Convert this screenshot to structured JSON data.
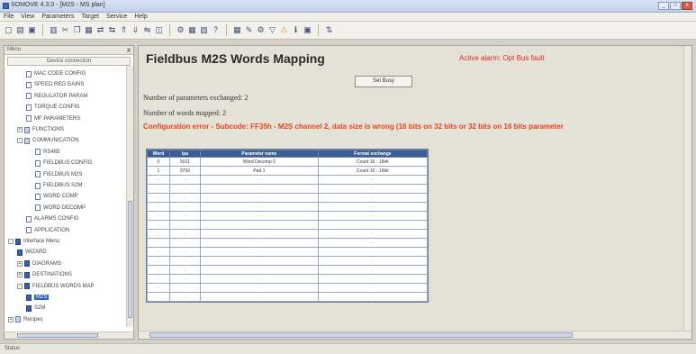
{
  "window": {
    "title": "SOMOVE 4.3.0 - [M2S - MS plan]",
    "minimize": "_",
    "maximize": "□",
    "close": "x"
  },
  "menu": [
    "File",
    "View",
    "Parameters",
    "Target",
    "Service",
    "Help"
  ],
  "toolbar": {
    "icons": [
      "new-icon",
      "open-icon",
      "save-icon",
      "print-icon",
      "cut-icon",
      "copy-icon",
      "paste-icon",
      "connect-icon",
      "disconnect-icon",
      "upload-icon",
      "download-icon",
      "compare-icon",
      "monitor-icon",
      "settings-icon",
      "grid-icon",
      "chart-icon",
      "help-icon",
      "warning-icon",
      "filter-icon",
      "info-icon"
    ]
  },
  "left_panel": {
    "header": "Menu",
    "close": "x",
    "subheader": "Device connection",
    "tree": [
      {
        "label": "MAC CODE CONFIG",
        "indent": 2,
        "type": "doc"
      },
      {
        "label": "SPEED REG GAINS",
        "indent": 2,
        "type": "doc"
      },
      {
        "label": "REGULATOR PARAM",
        "indent": 2,
        "type": "doc"
      },
      {
        "label": "TORQUE CONFIG",
        "indent": 2,
        "type": "doc"
      },
      {
        "label": "MF PARAMETERS",
        "indent": 2,
        "type": "doc"
      },
      {
        "label": "FUNCTIONS",
        "indent": 1,
        "type": "folder",
        "exp": "+"
      },
      {
        "label": "COMMUNICATION",
        "indent": 1,
        "type": "folder",
        "exp": "-"
      },
      {
        "label": "RS485",
        "indent": 3,
        "type": "doc"
      },
      {
        "label": "FIELDBUS CONFIG",
        "indent": 3,
        "type": "doc"
      },
      {
        "label": "FIELDBUS M2S",
        "indent": 3,
        "type": "doc"
      },
      {
        "label": "FIELDBUS S2M",
        "indent": 3,
        "type": "doc"
      },
      {
        "label": "WORD COMP",
        "indent": 3,
        "type": "doc"
      },
      {
        "label": "WORD DECOMP",
        "indent": 3,
        "type": "doc"
      },
      {
        "label": "ALARMS CONFIG",
        "indent": 2,
        "type": "doc"
      },
      {
        "label": "APPLICATION",
        "indent": 2,
        "type": "doc"
      },
      {
        "label": "Interface Menu",
        "indent": 0,
        "type": "book",
        "exp": "-"
      },
      {
        "label": "WIZARD",
        "indent": 1,
        "type": "book"
      },
      {
        "label": "DIAGRAMS",
        "indent": 1,
        "type": "book",
        "exp": "+"
      },
      {
        "label": "DESTINATIONS",
        "indent": 1,
        "type": "book",
        "exp": "+"
      },
      {
        "label": "FIELDBUS WORDS MAP",
        "indent": 1,
        "type": "book",
        "exp": "-"
      },
      {
        "label": "M2S",
        "indent": 2,
        "type": "book",
        "selected": true
      },
      {
        "label": "S2M",
        "indent": 2,
        "type": "book"
      },
      {
        "label": "Recipes",
        "indent": 0,
        "type": "folder",
        "exp": "+"
      }
    ]
  },
  "main": {
    "title": "Fieldbus M2S Words Mapping",
    "alarm": "Active alarm: Opt Bus fault",
    "set_button": "Set Busy",
    "params_exchanged": "Number of parameters exchanged: 2",
    "words_mapped": "Number of words mapped: 2",
    "config_error": "Configuration error - Subcode: FF35h - M2S channel 2, data size is wrong (16 bits on 32 bits or 32 bits on 16 bits parameter"
  },
  "table": {
    "columns": [
      "Word",
      "Ipa",
      "Parameter name",
      "Format exchange"
    ],
    "rows": [
      [
        "0",
        "5011",
        "Word Decomp 0",
        "Count 16 - 16bit"
      ],
      [
        "1",
        "3700",
        "Pad 1",
        "Count 16 - 16bit"
      ],
      [
        "-",
        "-",
        "-",
        "-"
      ],
      [
        "-",
        "-",
        "-",
        "-"
      ],
      [
        "-",
        "-",
        "-",
        "-"
      ],
      [
        "-",
        "-",
        "-",
        "-"
      ],
      [
        "-",
        "-",
        "-",
        "-"
      ],
      [
        "-",
        "-",
        "-",
        "-"
      ],
      [
        "-",
        "-",
        "-",
        "-"
      ],
      [
        "-",
        "-",
        "-",
        "-"
      ],
      [
        "-",
        "-",
        "-",
        "-"
      ],
      [
        "-",
        "-",
        "-",
        "-"
      ],
      [
        "-",
        "-",
        "-",
        "-"
      ],
      [
        "-",
        "-",
        "-",
        "-"
      ],
      [
        "-",
        "-",
        "-",
        "-"
      ],
      [
        "-",
        "-",
        "-",
        "-"
      ]
    ]
  },
  "status": {
    "text": "Status"
  }
}
